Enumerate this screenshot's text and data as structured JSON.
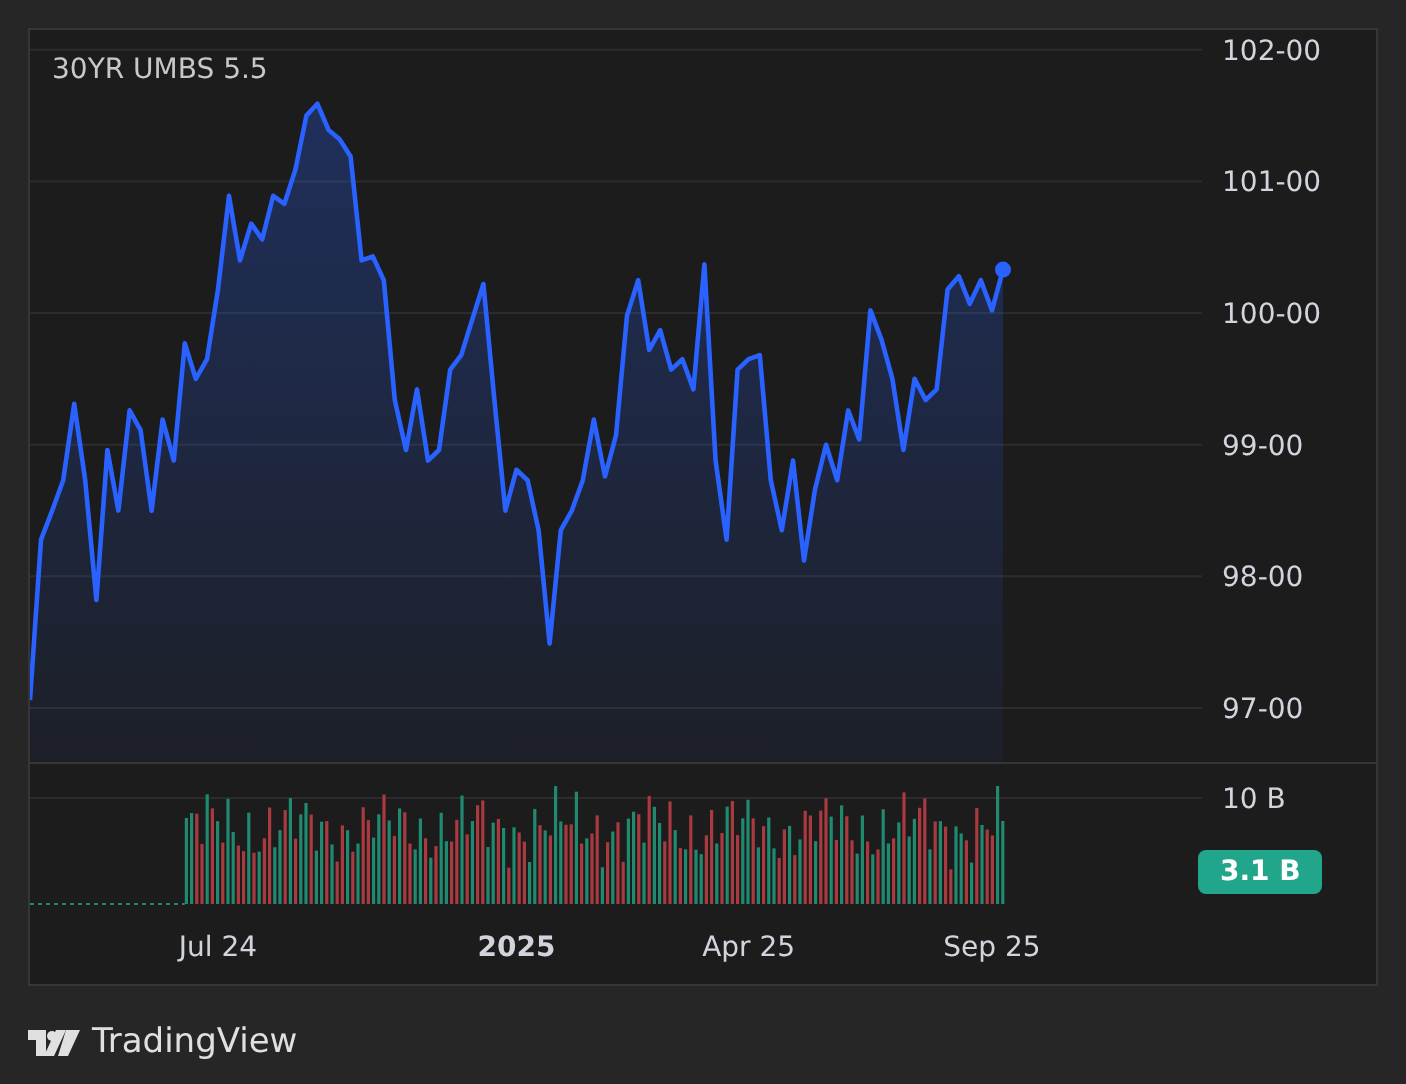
{
  "chart": {
    "title": "30YR UMBS 5.5",
    "price_axis": [
      "102-00",
      "101-00",
      "100-00",
      "99-00",
      "98-00",
      "97-00"
    ],
    "time_axis": [
      {
        "label": "Jul 24",
        "kind": "month"
      },
      {
        "label": "2025",
        "kind": "year"
      },
      {
        "label": "Apr 25",
        "kind": "month"
      },
      {
        "label": "Sep 25",
        "kind": "month"
      }
    ]
  },
  "volume": {
    "axis_label": "10 B",
    "last_value": "3.1 B"
  },
  "footer": {
    "brand": "TradingView"
  }
}
